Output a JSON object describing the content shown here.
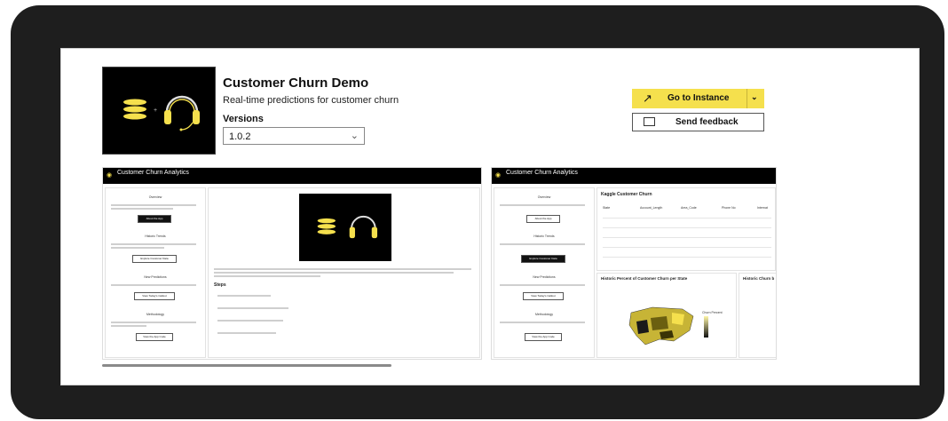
{
  "app": {
    "title": "Customer Churn Demo",
    "subtitle": "Real-time predictions for customer churn",
    "versions_label": "Versions",
    "version_value": "1.0.2"
  },
  "actions": {
    "primary_label": "Go to Instance",
    "secondary_label": "Send feedback"
  },
  "gallery": {
    "app_title": "Customer Churn Analytics",
    "sidebar": {
      "overview_title": "Overview",
      "overview_btn": "About the App",
      "trends_title": "Historic Trends",
      "trends_btn": "Explore Customer Data",
      "predictions_title": "New Predictions",
      "predictions_btn": "View Today's Callout",
      "method_title": "Methodology",
      "method_btn": "View the App Code"
    },
    "steps_title": "Steps",
    "table_title": "Kaggle Customer Churn",
    "table_headers": [
      "State",
      "Account_Length",
      "Area_Code",
      "Phone No",
      "Internat"
    ],
    "map_title": "Historic Percent of Customer Churn per State",
    "map_title_2": "Historic Churn b",
    "legend_title": "Churn Percent"
  },
  "colors": {
    "accent": "#f5e04d",
    "frame": "#1e1e1e"
  }
}
